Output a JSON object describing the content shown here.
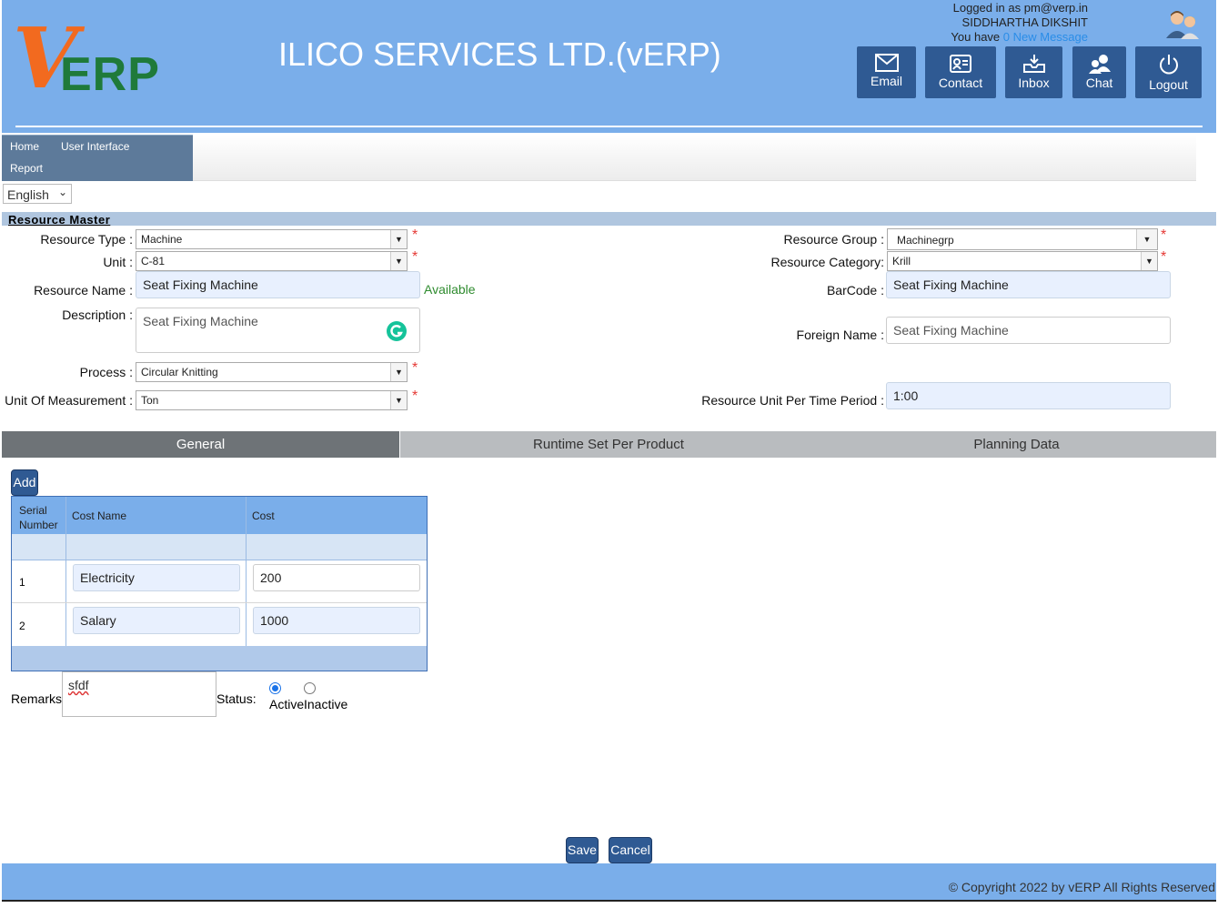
{
  "header": {
    "logo_v": "V",
    "logo_erp": "ERP",
    "title": "ILICO SERVICES LTD.(vERP)",
    "logged_in_prefix": "Logged in as ",
    "logged_in_email": "pm@verp.in",
    "user_name": "SIDDHARTHA DIKSHIT",
    "message_prefix": "You have ",
    "message_link": "0 New Message",
    "buttons": [
      {
        "label": "Email",
        "icon": "envelope-icon"
      },
      {
        "label": "Contact",
        "icon": "contact-card-icon"
      },
      {
        "label": "Inbox",
        "icon": "inbox-tray-icon"
      },
      {
        "label": "Chat",
        "icon": "chat-users-icon"
      },
      {
        "label": "Logout",
        "icon": "power-icon"
      }
    ]
  },
  "nav": {
    "items": [
      "Home",
      "User Interface",
      "Report"
    ],
    "language": "English"
  },
  "form": {
    "section_title": "Resource Master",
    "resource_type": {
      "label": "Resource Type :",
      "value": "Machine"
    },
    "unit": {
      "label": "Unit :",
      "value": "C-81"
    },
    "resource_name": {
      "label": "Resource Name :",
      "value": "Seat Fixing Machine",
      "status": "Available"
    },
    "description": {
      "label": "Description :",
      "value": "Seat Fixing Machine"
    },
    "process": {
      "label": "Process :",
      "value": "Circular Knitting"
    },
    "uom": {
      "label": "Unit Of Measurement :",
      "value": "Ton"
    },
    "resource_group": {
      "label": "Resource Group :",
      "value": "Machinegrp"
    },
    "resource_category": {
      "label": "Resource Category:",
      "value": "Krill"
    },
    "barcode": {
      "label": "BarCode :",
      "value": "Seat Fixing Machine"
    },
    "foreign_name": {
      "label": "Foreign Name :",
      "placeholder": "Seat Fixing Machine"
    },
    "unit_per_time": {
      "label": "Resource Unit Per Time Period :",
      "value": "1:00"
    },
    "required_mark": "*"
  },
  "tabs": [
    {
      "label": "General",
      "active": true
    },
    {
      "label": "Runtime Set Per Product",
      "active": false
    },
    {
      "label": "Planning Data",
      "active": false
    }
  ],
  "cost_table": {
    "add_label": "Add",
    "headers": [
      "Serial Number",
      "Cost Name",
      "Cost"
    ],
    "rows": [
      {
        "serial": "1",
        "name": "Electricity",
        "cost": "200"
      },
      {
        "serial": "2",
        "name": "Salary",
        "cost": "1000"
      }
    ]
  },
  "remarks": {
    "label": "Remarks:",
    "value": "sfdf"
  },
  "status": {
    "label": "Status:",
    "options": [
      "Active",
      "Inactive"
    ],
    "selected": "Active"
  },
  "actions": {
    "save": "Save",
    "cancel": "Cancel"
  },
  "footer": {
    "copyright": "© Copyright 2022 by vERP All Rights Reserved"
  },
  "colors": {
    "header_bg": "#7aaeea",
    "button_bg": "#2f5a93",
    "logo_orange": "#f26a1f",
    "logo_green": "#1f7a3a",
    "required": "#e53935",
    "available": "#2e8b2e"
  }
}
